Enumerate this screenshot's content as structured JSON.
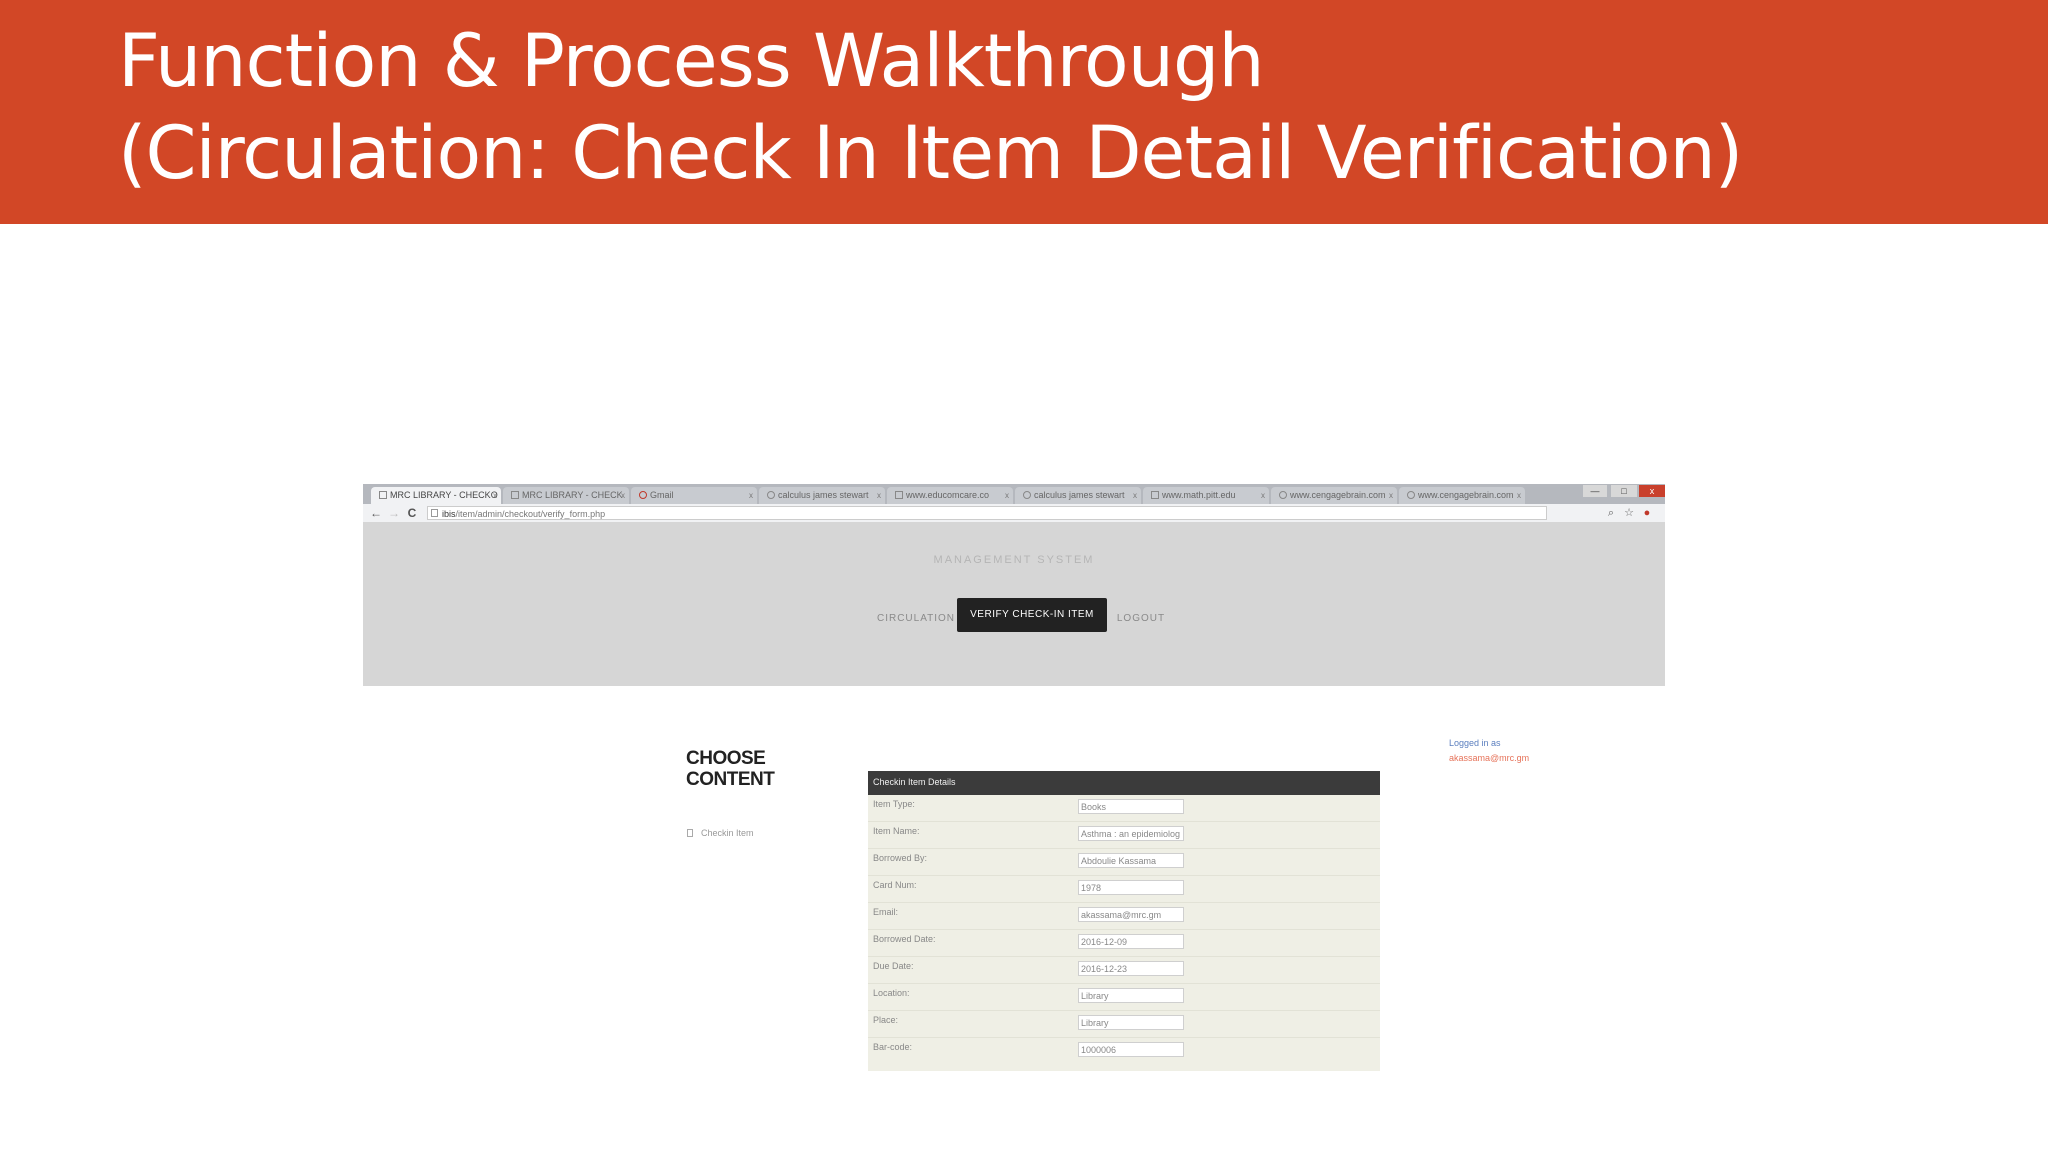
{
  "slide": {
    "title_line1": "Function & Process Walkthrough",
    "title_line2": "(Circulation: Check In Item Detail Verification)"
  },
  "browser": {
    "tabs": [
      {
        "label": "MRC LIBRARY - CHECKO",
        "active": true
      },
      {
        "label": "MRC LIBRARY - CHECK",
        "active": false
      },
      {
        "label": "Gmail",
        "active": false
      },
      {
        "label": "calculus james stewart",
        "active": false
      },
      {
        "label": "www.educomcare.co",
        "active": false
      },
      {
        "label": "calculus james stewart",
        "active": false
      },
      {
        "label": "www.math.pitt.edu",
        "active": false
      },
      {
        "label": "www.cengagebrain.com",
        "active": false
      },
      {
        "label": "www.cengagebrain.com",
        "active": false
      }
    ],
    "window_controls": {
      "minimize": "—",
      "maximize": "□",
      "close": "x"
    },
    "nav": {
      "back": "←",
      "forward": "→",
      "reload": "C"
    },
    "url_host": "ibis",
    "url_path": "/item/admin/checkout/verify_form.php",
    "toolbar_icons": [
      "search-icon",
      "star-icon",
      "extension-icon"
    ]
  },
  "site": {
    "system_title": "MANAGEMENT SYSTEM",
    "menu": {
      "circulation": "CIRCULATION",
      "verify_checkin": "VERIFY CHECK-IN ITEM",
      "logout": "LOGOUT"
    }
  },
  "sidebar": {
    "title_line1": "CHOOSE",
    "title_line2": "CONTENT",
    "item_label": "Checkin Item"
  },
  "user": {
    "logged_label": "Logged in as",
    "email": "akassama@mrc.gm"
  },
  "details": {
    "header": "Checkin Item Details",
    "rows": [
      {
        "label": "Item Type:",
        "value": "Books"
      },
      {
        "label": "Item Name:",
        "value": "Asthma : an epidemiolog"
      },
      {
        "label": "Borrowed By:",
        "value": "Abdoulie Kassama"
      },
      {
        "label": "Card Num:",
        "value": "1978"
      },
      {
        "label": "Email:",
        "value": "akassama@mrc.gm"
      },
      {
        "label": "Borrowed Date:",
        "value": "2016-12-09"
      },
      {
        "label": "Due Date:",
        "value": "2016-12-23"
      },
      {
        "label": "Location:",
        "value": "Library"
      },
      {
        "label": "Place:",
        "value": "Library"
      },
      {
        "label": "Bar-code:",
        "value": "1000006"
      }
    ]
  }
}
